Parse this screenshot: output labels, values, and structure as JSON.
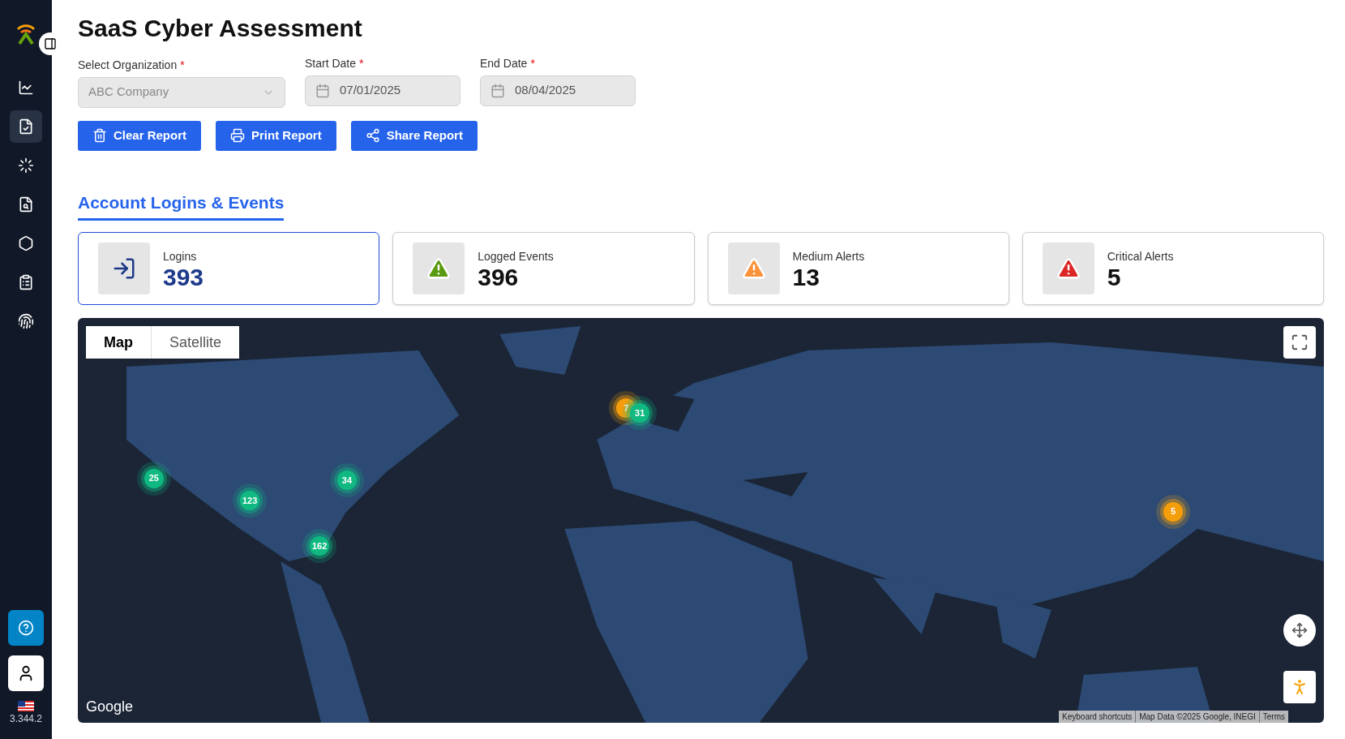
{
  "sidebar": {
    "items": [
      {
        "kind": "chart",
        "selected": false
      },
      {
        "kind": "report",
        "selected": true
      },
      {
        "kind": "scan",
        "selected": false
      },
      {
        "kind": "audit",
        "selected": false
      },
      {
        "kind": "hexagon",
        "selected": false
      },
      {
        "kind": "clipboard",
        "selected": false
      },
      {
        "kind": "fingerprint",
        "selected": false
      }
    ],
    "version": "3.344.2"
  },
  "page": {
    "title": "SaaS Cyber Assessment"
  },
  "filters": [
    {
      "label": "Select Organization",
      "kind": "select",
      "value": "ABC Company",
      "required_mark": "*"
    },
    {
      "label": "Start Date",
      "kind": "date",
      "value": "07/01/2025",
      "required_mark": "*"
    },
    {
      "label": "End Date",
      "kind": "date",
      "value": "08/04/2025",
      "required_mark": "*"
    }
  ],
  "actions": [
    {
      "label": "Clear Report",
      "kind": "trash"
    },
    {
      "label": "Print Report",
      "kind": "print"
    },
    {
      "label": "Share Report",
      "kind": "share"
    }
  ],
  "section": {
    "title": "Account Logins & Events"
  },
  "stats": [
    {
      "label": "Logins",
      "value": "393",
      "kind": "login",
      "selected": true
    },
    {
      "label": "Logged Events",
      "value": "396",
      "kind": "warning",
      "color": "#5a9a10",
      "selected": false
    },
    {
      "label": "Medium Alerts",
      "value": "13",
      "kind": "warning",
      "color": "#fb923c",
      "selected": false
    },
    {
      "label": "Critical Alerts",
      "value": "5",
      "kind": "warning",
      "color": "#dc2626",
      "selected": false
    }
  ],
  "map": {
    "types": [
      {
        "label": "Map",
        "selected": true
      },
      {
        "label": "Satellite",
        "selected": false
      }
    ],
    "markers": [
      {
        "count": "25",
        "color": "#10b981"
      },
      {
        "count": "123",
        "color": "#10b981"
      },
      {
        "count": "34",
        "color": "#10b981"
      },
      {
        "count": "162",
        "color": "#10b981"
      },
      {
        "count": "7",
        "color": "#f59e0b"
      },
      {
        "count": "31",
        "color": "#10b981"
      },
      {
        "count": "5",
        "color": "#f59e0b"
      }
    ],
    "logo": "Google",
    "attribution": [
      "Keyboard shortcuts",
      "Map Data ©2025 Google, INEGI",
      "Terms"
    ]
  }
}
